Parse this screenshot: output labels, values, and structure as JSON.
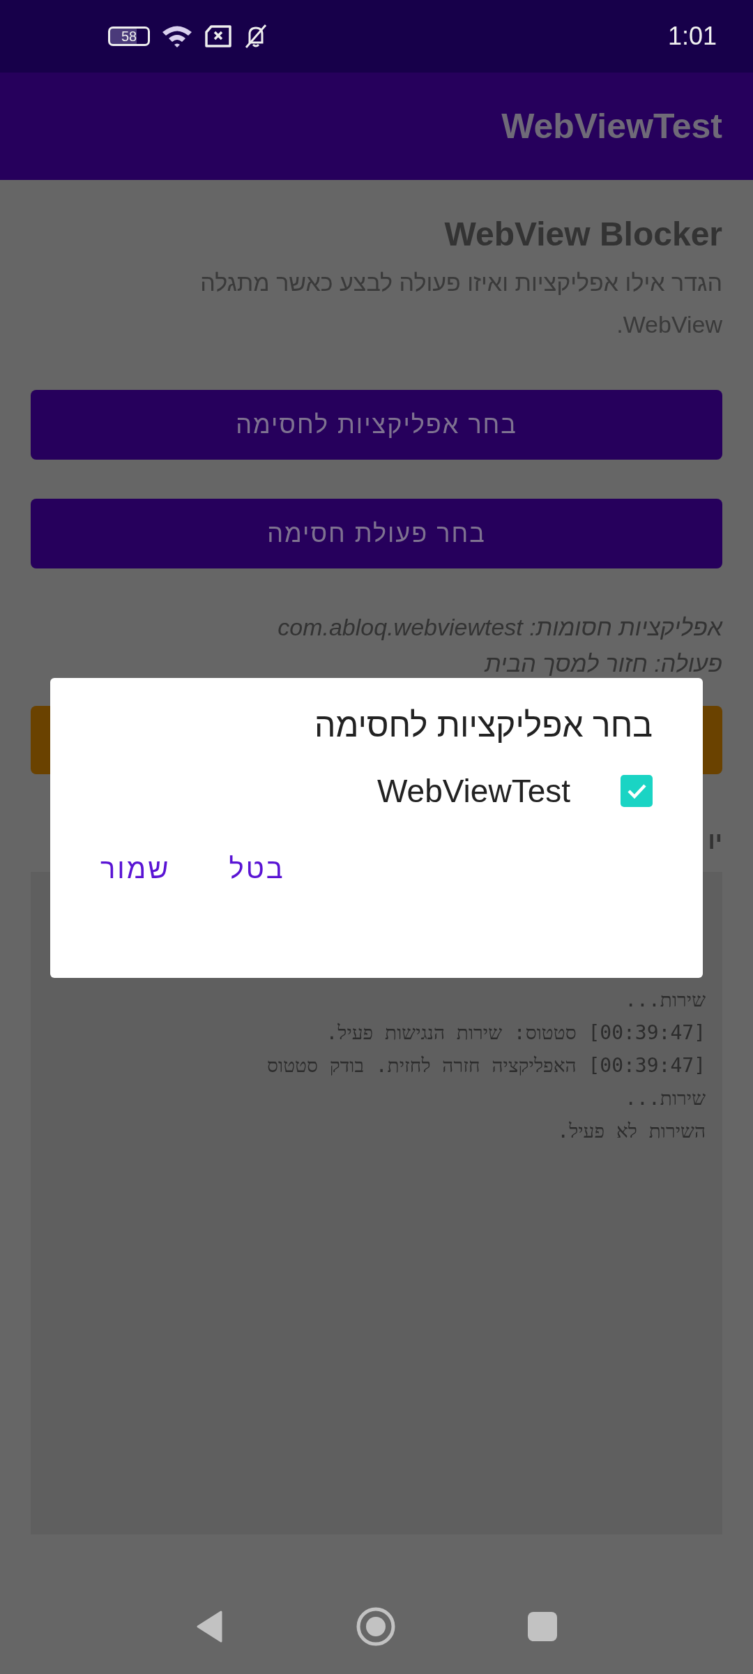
{
  "status_bar": {
    "battery": "58",
    "time": "1:01"
  },
  "app_bar": {
    "title": "WebViewTest"
  },
  "page": {
    "title": "WebView Blocker",
    "description": "הגדר אילו אפליקציות ואיזו פעולה לבצע כאשר מתגלה WebView.",
    "buttons": [
      "בחר אפליקציות לחסימה",
      "בחר פעולת חסימה"
    ],
    "blocked_apps": "אפליקציות חסומות: com.abloq.webviewtest",
    "action": "פעולה: חזור למסך הבית",
    "log_heading": "יו",
    "log_lines": [
      "שירות...",
      "[00:39:47] סטטוס: שירות הנגישות פעיל.",
      "[00:39:47] האפליקציה חזרה לחזית. בודק סטטוס",
      "שירות...",
      "השירות לא פעיל."
    ]
  },
  "dialog": {
    "title": "בחר אפליקציות לחסימה",
    "items": [
      {
        "label": "WebViewTest",
        "checked": true
      }
    ],
    "buttons": [
      "בטל",
      "שמור"
    ]
  }
}
